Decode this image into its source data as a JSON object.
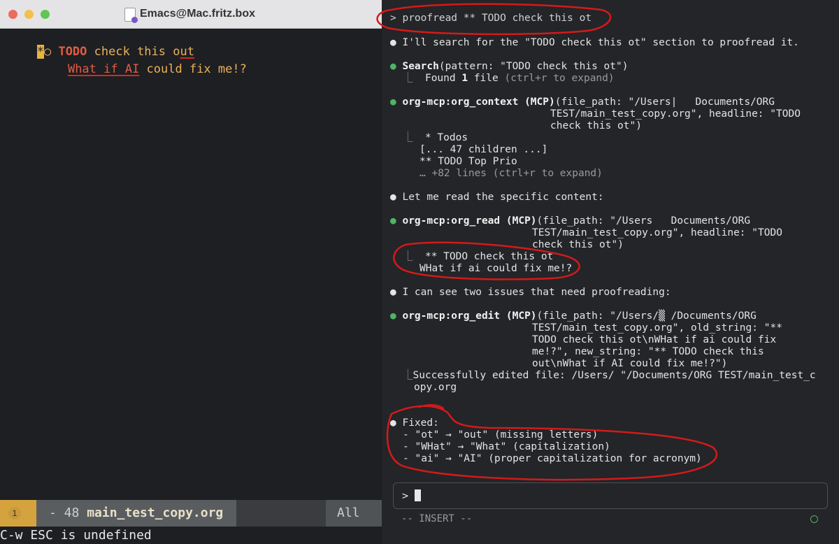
{
  "emacs": {
    "window_title": "Emacs@Mac.fritz.box",
    "buffer": {
      "star": "*",
      "bullet": "○",
      "todo": "TODO",
      "heading_a": "check this o",
      "heading_b": "ut",
      "line2_a": "What if AI",
      "line2_b": " could fix me!?"
    },
    "modeline": {
      "badge": "1",
      "prefix": "- 48 ",
      "filename": "main_test_copy.org",
      "position": "All"
    },
    "echo_area": "C-w ESC is undefined"
  },
  "terminal": {
    "prompt_line": "> proofread ** TODO check this ot",
    "lines": {
      "l1": "I'll search for the \"TODO check this ot\" section to proofread it.",
      "search_tool": "Search",
      "search_args": "(pattern: \"TODO check this ot\")",
      "search_result_a": "Found ",
      "search_result_b": "1",
      "search_result_c": " file ",
      "search_result_hint": "(ctrl+r to expand)",
      "ctx_tool": "org-mcp:org_context (MCP)",
      "ctx_args1": "(file_path: \"/Users|   Documents/ORG",
      "ctx_args2": "TEST/main_test_copy.org\", headline: \"TODO",
      "ctx_args3": "check this ot\")",
      "ctx_out1": "* Todos",
      "ctx_out2": "[... 47 children ...]",
      "ctx_out3": "** TODO Top Prio",
      "ctx_out4": "… +82 lines (ctrl+r to expand)",
      "l_read_intro": "Let me read the specific content:",
      "read_tool": "org-mcp:org_read (MCP)",
      "read_args1": "(file_path: \"/Users   Documents/ORG",
      "read_args2": "TEST/main_test_copy.org\", headline: \"TODO",
      "read_args3": "check this ot\")",
      "read_out1": "** TODO check this ot",
      "read_out2": "WHat if ai could fix me!?",
      "l_issues": "I can see two issues that need proofreading:",
      "edit_tool": "org-mcp:org_edit (MCP)",
      "edit_args1": "(file_path: \"/Users/▒ /Documents/ORG",
      "edit_args2": "TEST/main_test_copy.org\", old_string: \"**",
      "edit_args3": "TODO check this ot\\nWHat if ai could fix",
      "edit_args4": "me!?\", new_string: \"** TODO check this",
      "edit_args5": "out\\nWhat if AI could fix me!?\")",
      "edit_out1": "Successfully edited file: /Users/ \"/Documents/ORG TEST/main_test_c",
      "edit_out2": "opy.org",
      "fixed_title": "Fixed:",
      "fix1": "- \"ot\" → \"out\" (missing letters)",
      "fix2": "- \"WHat\" → \"What\" (capitalization)",
      "fix3": "- \"ai\" → \"AI\" (proper capitalization for acronym)"
    },
    "input_prompt": ">",
    "mode_indicator": "-- INSERT --"
  },
  "colors": {
    "annotation": "#d41a1a",
    "todo_keyword": "#e25c45",
    "heading": "#eab15b",
    "tool_dot": "#4fb463"
  }
}
